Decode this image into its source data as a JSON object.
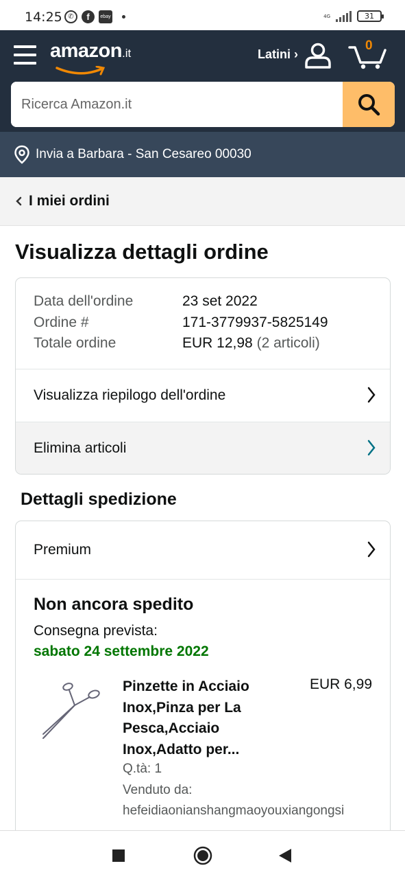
{
  "status_bar": {
    "time": "14:25",
    "icons": [
      "whatsapp-icon",
      "facebook-icon",
      "ebay-icon"
    ],
    "ebay_label": "ebay",
    "network": "4G",
    "battery": "31"
  },
  "header": {
    "logo_text": "amazon",
    "logo_tld": ".it",
    "account_label": "Latini ›",
    "cart_count": "0",
    "search_placeholder": "Ricerca Amazon.it",
    "colors": {
      "header_bg": "#232f3e",
      "search_button": "#febd69",
      "cart_count": "#f08804"
    }
  },
  "delivery": {
    "text": "Invia a Barbara - San Cesareo 00030",
    "bg": "#37475a"
  },
  "breadcrumb": {
    "label": "I miei ordini"
  },
  "page": {
    "title": "Visualizza dettagli ordine"
  },
  "order": {
    "date_label": "Data dell'ordine",
    "date_value": "23 set 2022",
    "number_label": "Ordine #",
    "number_value": "171-3779937-5825149",
    "total_label": "Totale ordine",
    "total_value": "EUR 12,98",
    "total_items": "(2 articoli)",
    "summary_link": "Visualizza riepilogo dell'ordine",
    "delete_link": "Elimina articoli"
  },
  "shipping": {
    "section_title": "Dettagli spedizione",
    "method": "Premium",
    "status": "Non ancora spedito",
    "eta_label": "Consegna prevista:",
    "eta_date": "sabato 24 settembre 2022",
    "eta_color": "#007600",
    "item": {
      "title": "Pinzette in Acciaio Inox,Pinza per La Pesca,Acciaio Inox,Adatto per...",
      "price": "EUR 6,99",
      "quantity": "Q.tà: 1",
      "sold_by_label": "Venduto da:",
      "seller": "hefeidiaonianshangmaoyouxiangongsi"
    }
  },
  "navbar": {
    "buttons": [
      "recents-button",
      "home-button",
      "back-button"
    ]
  }
}
